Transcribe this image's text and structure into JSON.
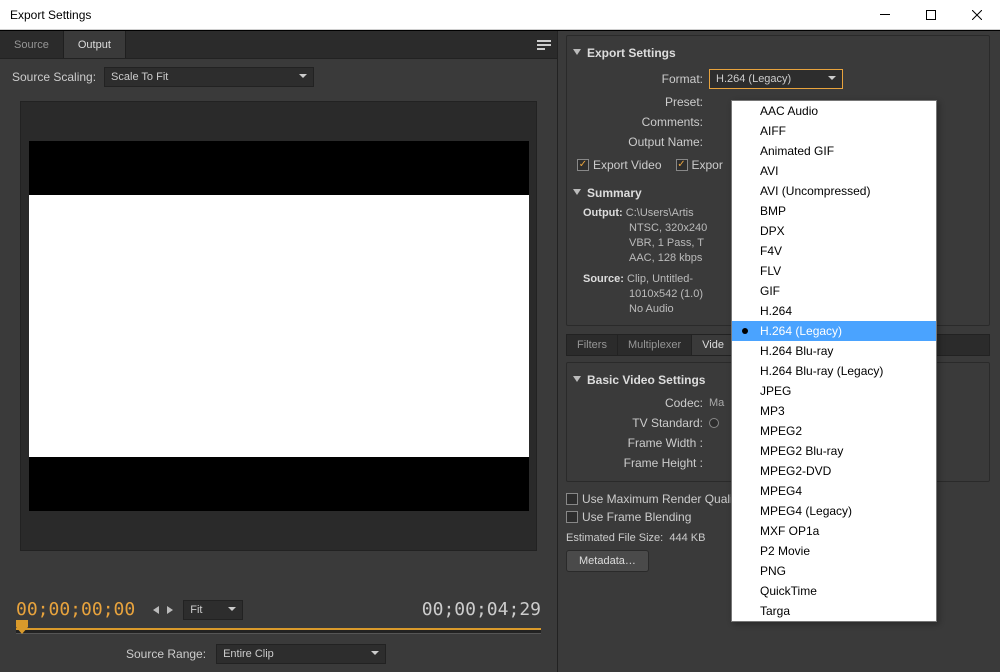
{
  "window": {
    "title": "Export Settings"
  },
  "left": {
    "tabs": {
      "source": "Source",
      "output": "Output"
    },
    "scaling_label": "Source Scaling:",
    "scaling_value": "Scale To Fit",
    "timecode_start": "00;00;00;00",
    "timecode_end": "00;00;04;29",
    "fit_label": "Fit",
    "source_range_label": "Source Range:",
    "source_range_value": "Entire Clip"
  },
  "right": {
    "section_title": "Export Settings",
    "format_label": "Format:",
    "format_value": "H.264 (Legacy)",
    "preset_label": "Preset:",
    "comments_label": "Comments:",
    "outputname_label": "Output Name:",
    "export_video": "Export Video",
    "export_audio": "Expor",
    "summary_title": "Summary",
    "summary_output_label": "Output:",
    "summary_output_l1": "C:\\Users\\Artis",
    "summary_output_l2": "NTSC, 320x240",
    "summary_output_l3": "VBR, 1 Pass, T",
    "summary_output_l4": "AAC, 128 kbps",
    "summary_source_label": "Source:",
    "summary_source_l1": "Clip, Untitled-",
    "summary_source_l2": "1010x542 (1.0)",
    "summary_source_l3": "No Audio",
    "tabs2": {
      "filters": "Filters",
      "multiplexer": "Multiplexer",
      "video": "Vide"
    },
    "bvs_title": "Basic Video Settings",
    "codec_label": "Codec:",
    "codec_value": "Ma",
    "tvstd_label": "TV Standard:",
    "fw_label": "Frame Width :",
    "fh_label": "Frame Height :",
    "maxrender": "Use Maximum Render Qualit",
    "useblend": "Use Frame Blending",
    "est_label": "Estimated File Size:",
    "est_value": "444 KB",
    "metadata_btn": "Metadata…"
  },
  "format_options": [
    "AAC Audio",
    "AIFF",
    "Animated GIF",
    "AVI",
    "AVI (Uncompressed)",
    "BMP",
    "DPX",
    "F4V",
    "FLV",
    "GIF",
    "H.264",
    "H.264 (Legacy)",
    "H.264 Blu-ray",
    "H.264 Blu-ray (Legacy)",
    "JPEG",
    "MP3",
    "MPEG2",
    "MPEG2 Blu-ray",
    "MPEG2-DVD",
    "MPEG4",
    "MPEG4 (Legacy)",
    "MXF OP1a",
    "P2 Movie",
    "PNG",
    "QuickTime",
    "Targa"
  ],
  "format_selected_index": 11
}
